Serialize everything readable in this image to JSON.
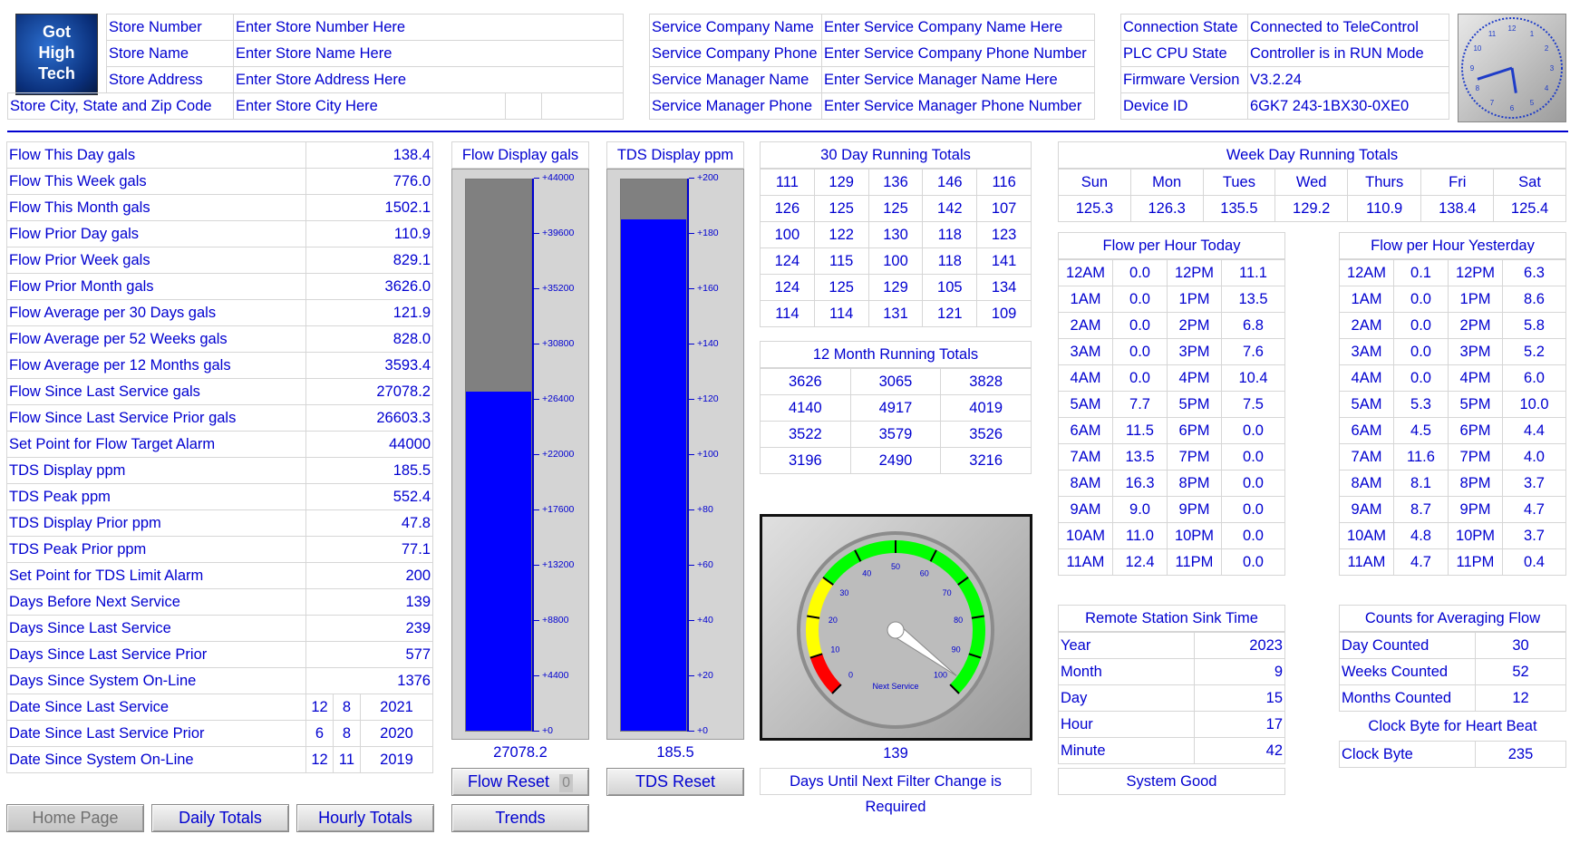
{
  "logo": {
    "lines": [
      "Got",
      "High",
      "Tech"
    ]
  },
  "store_info": [
    {
      "label": "Store Number",
      "value": "Enter Store Number Here"
    },
    {
      "label": "Store Name",
      "value": "Enter Store Name Here"
    },
    {
      "label": "Store Address",
      "value": "Enter Store Address Here"
    },
    {
      "label": "Store City, State and Zip Code",
      "value": "Enter Store City Here"
    }
  ],
  "service_info": [
    {
      "label": "Service Company Name",
      "value": "Enter Service Company Name Here"
    },
    {
      "label": "Service Company Phone",
      "value": "Enter Service Company Phone Number"
    },
    {
      "label": "Service Manager Name",
      "value": "Enter Service Manager Name Here"
    },
    {
      "label": "Service Manager Phone",
      "value": "Enter Service Manager Phone Number"
    }
  ],
  "system_info": [
    {
      "label": "Connection State",
      "value": "Connected to TeleControl"
    },
    {
      "label": "PLC CPU State",
      "value": "Controller is in RUN Mode"
    },
    {
      "label": "Firmware Version",
      "value": "V3.2.24"
    },
    {
      "label": "Device ID",
      "value": "6GK7 243-1BX30-0XE0"
    }
  ],
  "clock": {
    "numbers": [
      "12",
      "1",
      "2",
      "3",
      "4",
      "5",
      "6",
      "7",
      "8",
      "9",
      "10",
      "11"
    ],
    "hour": 5,
    "minute": 42
  },
  "stats": [
    {
      "label": "Flow This Day gals",
      "value": "138.4"
    },
    {
      "label": "Flow This Week gals",
      "value": "776.0"
    },
    {
      "label": "Flow This Month gals",
      "value": "1502.1"
    },
    {
      "label": "Flow Prior Day gals",
      "value": "110.9"
    },
    {
      "label": "Flow Prior Week gals",
      "value": "829.1"
    },
    {
      "label": "Flow Prior Month gals",
      "value": "3626.0"
    },
    {
      "label": "Flow Average per 30 Days gals",
      "value": "121.9"
    },
    {
      "label": "Flow Average per 52 Weeks gals",
      "value": "828.0"
    },
    {
      "label": "Flow Average per 12 Months gals",
      "value": "3593.4"
    },
    {
      "label": "Flow Since Last Service gals",
      "value": "27078.2"
    },
    {
      "label": "Flow Since Last Service Prior gals",
      "value": "26603.3"
    },
    {
      "label": "Set Point for Flow Target Alarm",
      "value": "44000"
    },
    {
      "label": "TDS Display ppm",
      "value": "185.5"
    },
    {
      "label": "TDS Peak ppm",
      "value": "552.4"
    },
    {
      "label": "TDS Display Prior ppm",
      "value": "47.8"
    },
    {
      "label": "TDS Peak Prior ppm",
      "value": "77.1"
    },
    {
      "label": "Set Point for TDS Limit Alarm",
      "value": "200"
    },
    {
      "label": "Days Before Next Service",
      "value": "139"
    },
    {
      "label": "Days Since Last Service",
      "value": "239"
    },
    {
      "label": "Days Since Last Service Prior",
      "value": "577"
    },
    {
      "label": "Days Since System On-Line",
      "value": "1376"
    }
  ],
  "dates": [
    {
      "label": "Date Since Last Service",
      "m": "12",
      "d": "8",
      "y": "2021"
    },
    {
      "label": "Date Since Last Service Prior",
      "m": "6",
      "d": "8",
      "y": "2020"
    },
    {
      "label": "Date Since System On-Line",
      "m": "12",
      "d": "11",
      "y": "2019"
    }
  ],
  "flow_bar": {
    "title": "Flow Display gals",
    "value": "27078.2",
    "level": 27078.2,
    "max": 44000,
    "scale": [
      "+44000",
      "+39600",
      "+35200",
      "+30800",
      "+26400",
      "+22000",
      "+17600",
      "+13200",
      "+8800",
      "+4400",
      "+0"
    ],
    "reset_label": "Flow Reset",
    "reset_badge": "0"
  },
  "tds_bar": {
    "title": "TDS Display ppm",
    "value": "185.5",
    "level": 185.5,
    "max": 200,
    "scale": [
      "+200",
      "+180",
      "+160",
      "+140",
      "+120",
      "+100",
      "+80",
      "+60",
      "+40",
      "+20",
      "+0"
    ],
    "reset_label": "TDS Reset"
  },
  "running30": {
    "title": "30 Day Running Totals",
    "rows": [
      [
        "111",
        "129",
        "136",
        "146",
        "116"
      ],
      [
        "126",
        "125",
        "125",
        "142",
        "107"
      ],
      [
        "100",
        "122",
        "130",
        "118",
        "123"
      ],
      [
        "124",
        "115",
        "100",
        "118",
        "141"
      ],
      [
        "124",
        "125",
        "129",
        "105",
        "134"
      ],
      [
        "114",
        "114",
        "131",
        "121",
        "109"
      ]
    ]
  },
  "running12": {
    "title": "12 Month Running Totals",
    "rows": [
      [
        "3626",
        "3065",
        "3828"
      ],
      [
        "4140",
        "4917",
        "4019"
      ],
      [
        "3522",
        "3579",
        "3526"
      ],
      [
        "3196",
        "2490",
        "3216"
      ]
    ]
  },
  "gauge": {
    "value": 97,
    "label": "Next Service",
    "ticks": [
      "0",
      "10",
      "20",
      "30",
      "40",
      "50",
      "60",
      "70",
      "80",
      "90",
      "100"
    ],
    "days": "139",
    "caption": "Days Until Next Filter Change is Required"
  },
  "weekday": {
    "title": "Week Day Running Totals",
    "days": [
      "Sun",
      "Mon",
      "Tues",
      "Wed",
      "Thurs",
      "Fri",
      "Sat"
    ],
    "values": [
      "125.3",
      "126.3",
      "135.5",
      "129.2",
      "110.9",
      "138.4",
      "125.4"
    ]
  },
  "hour_today": {
    "title": "Flow per Hour Today",
    "am": [
      [
        "12AM",
        "0.0"
      ],
      [
        "1AM",
        "0.0"
      ],
      [
        "2AM",
        "0.0"
      ],
      [
        "3AM",
        "0.0"
      ],
      [
        "4AM",
        "0.0"
      ],
      [
        "5AM",
        "7.7"
      ],
      [
        "6AM",
        "11.5"
      ],
      [
        "7AM",
        "13.5"
      ],
      [
        "8AM",
        "16.3"
      ],
      [
        "9AM",
        "9.0"
      ],
      [
        "10AM",
        "11.0"
      ],
      [
        "11AM",
        "12.4"
      ]
    ],
    "pm": [
      [
        "12PM",
        "11.1"
      ],
      [
        "1PM",
        "13.5"
      ],
      [
        "2PM",
        "6.8"
      ],
      [
        "3PM",
        "7.6"
      ],
      [
        "4PM",
        "10.4"
      ],
      [
        "5PM",
        "7.5"
      ],
      [
        "6PM",
        "0.0"
      ],
      [
        "7PM",
        "0.0"
      ],
      [
        "8PM",
        "0.0"
      ],
      [
        "9PM",
        "0.0"
      ],
      [
        "10PM",
        "0.0"
      ],
      [
        "11PM",
        "0.0"
      ]
    ]
  },
  "hour_yesterday": {
    "title": "Flow per Hour Yesterday",
    "am": [
      [
        "12AM",
        "0.1"
      ],
      [
        "1AM",
        "0.0"
      ],
      [
        "2AM",
        "0.0"
      ],
      [
        "3AM",
        "0.0"
      ],
      [
        "4AM",
        "0.0"
      ],
      [
        "5AM",
        "5.3"
      ],
      [
        "6AM",
        "4.5"
      ],
      [
        "7AM",
        "11.6"
      ],
      [
        "8AM",
        "8.1"
      ],
      [
        "9AM",
        "8.7"
      ],
      [
        "10AM",
        "4.8"
      ],
      [
        "11AM",
        "4.7"
      ]
    ],
    "pm": [
      [
        "12PM",
        "6.3"
      ],
      [
        "1PM",
        "8.6"
      ],
      [
        "2PM",
        "5.8"
      ],
      [
        "3PM",
        "5.2"
      ],
      [
        "4PM",
        "6.0"
      ],
      [
        "5PM",
        "10.0"
      ],
      [
        "6PM",
        "4.4"
      ],
      [
        "7PM",
        "4.0"
      ],
      [
        "8PM",
        "3.7"
      ],
      [
        "9PM",
        "4.7"
      ],
      [
        "10PM",
        "3.7"
      ],
      [
        "11PM",
        "0.4"
      ]
    ]
  },
  "sink_time": {
    "title": "Remote Station Sink Time",
    "rows": [
      [
        "Year",
        "2023"
      ],
      [
        "Month",
        "9"
      ],
      [
        "Day",
        "15"
      ],
      [
        "Hour",
        "17"
      ],
      [
        "Minute",
        "42"
      ]
    ],
    "status": "System Good"
  },
  "counts": {
    "title": "Counts for Averaging Flow",
    "rows": [
      [
        "Day Counted",
        "30"
      ],
      [
        "Weeks Counted",
        "52"
      ],
      [
        "Months Counted",
        "12"
      ]
    ],
    "heartbeat_title": "Clock Byte for Heart Beat",
    "clock_byte": [
      "Clock Byte",
      "235"
    ]
  },
  "nav": {
    "home": "Home Page",
    "daily": "Daily Totals",
    "hourly": "Hourly Totals",
    "trends": "Trends"
  }
}
